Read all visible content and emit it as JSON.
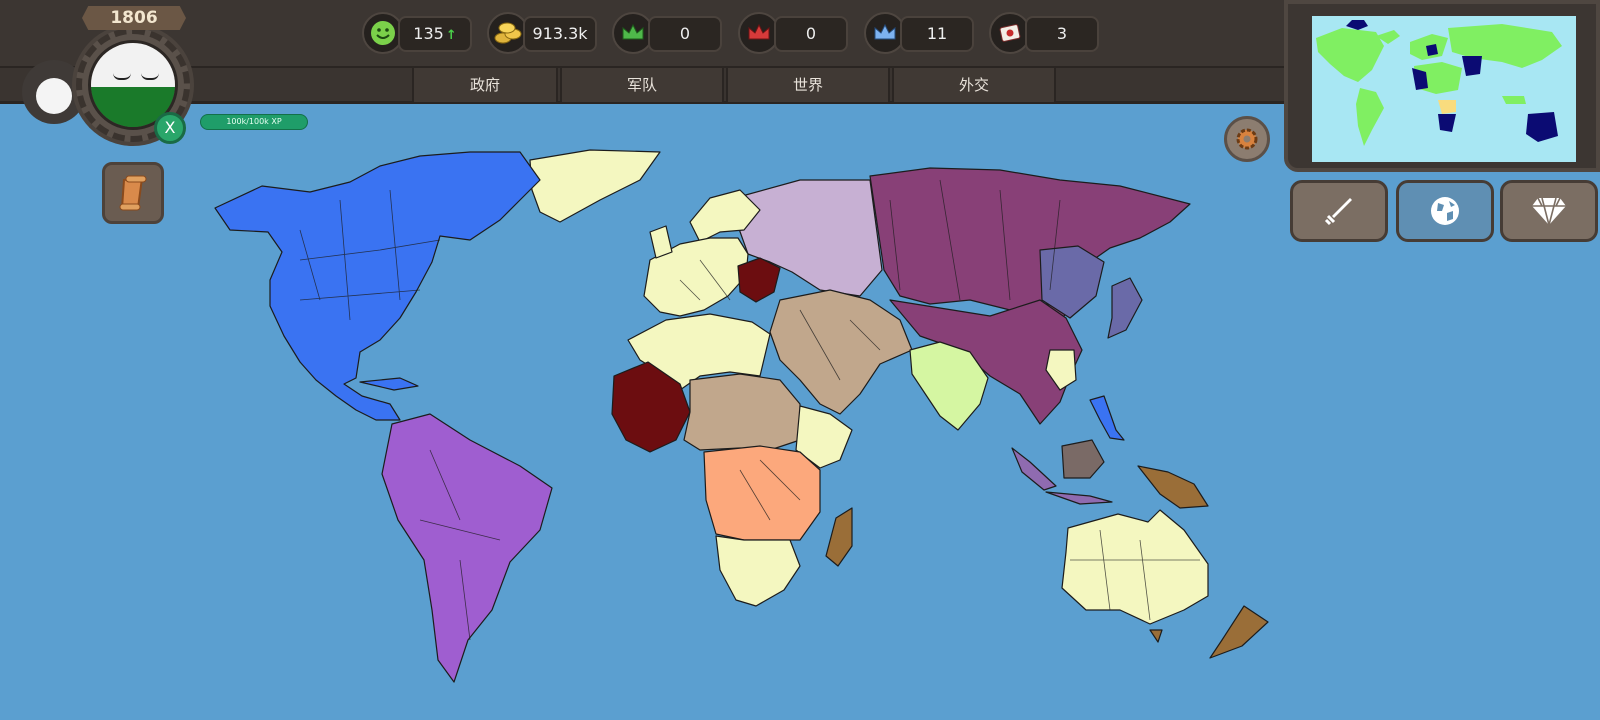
{
  "profile": {
    "year": "1806",
    "close_label": "X",
    "xp_label": "100k/100k XP"
  },
  "stats": [
    {
      "icon": "happiness-icon",
      "value": "135",
      "trend": "↑"
    },
    {
      "icon": "gold-coins-icon",
      "value": "913.3k",
      "trend": "↑"
    },
    {
      "icon": "green-crown-icon",
      "value": "0"
    },
    {
      "icon": "red-crown-icon",
      "value": "0"
    },
    {
      "icon": "blue-crown-icon",
      "value": "11"
    },
    {
      "icon": "flag-card-icon",
      "value": "3"
    }
  ],
  "tabs": [
    {
      "label": "政府"
    },
    {
      "label": "军队"
    },
    {
      "label": "世界"
    },
    {
      "label": "外交"
    }
  ],
  "colors": {
    "ocean": "#5b9fd0",
    "player_territory": "#6c0d10",
    "north_america": "#3a73f2",
    "south_america": "#9f5ed0",
    "russia": "#884077",
    "eastern_europe": "#c7b0d3",
    "europe_neutral": "#f4f7c0",
    "middle_east": "#c1a78c",
    "central_africa": "#fca87c",
    "india": "#d5f6a2",
    "indonesia": "#8f6bb0",
    "australia": "#f4f7c0",
    "minimap_land": "#80ef62",
    "minimap_enemy": "#0b0b73",
    "minimap_highlight": "#f9dc7e"
  },
  "right_buttons": [
    {
      "icon": "sword-icon"
    },
    {
      "icon": "globe-icon"
    },
    {
      "icon": "diamond-icon"
    }
  ]
}
